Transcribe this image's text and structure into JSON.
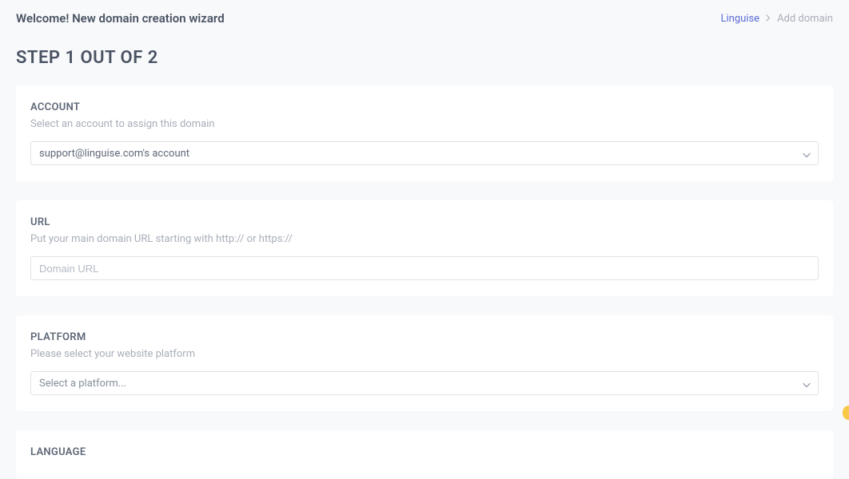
{
  "header": {
    "title": "Welcome! New domain creation wizard"
  },
  "breadcrumb": {
    "link": "Linguise",
    "current": "Add domain"
  },
  "step": {
    "title": "STEP 1 OUT OF 2"
  },
  "sections": {
    "account": {
      "label": "ACCOUNT",
      "sublabel": "Select an account to assign this domain",
      "selected": "support@linguise.com's account"
    },
    "url": {
      "label": "URL",
      "sublabel": "Put your main domain URL starting with http:// or https://",
      "placeholder": "Domain URL"
    },
    "platform": {
      "label": "PLATFORM",
      "sublabel": "Please select your website platform",
      "selected": "Select a platform..."
    },
    "language": {
      "label": "LANGUAGE"
    }
  }
}
